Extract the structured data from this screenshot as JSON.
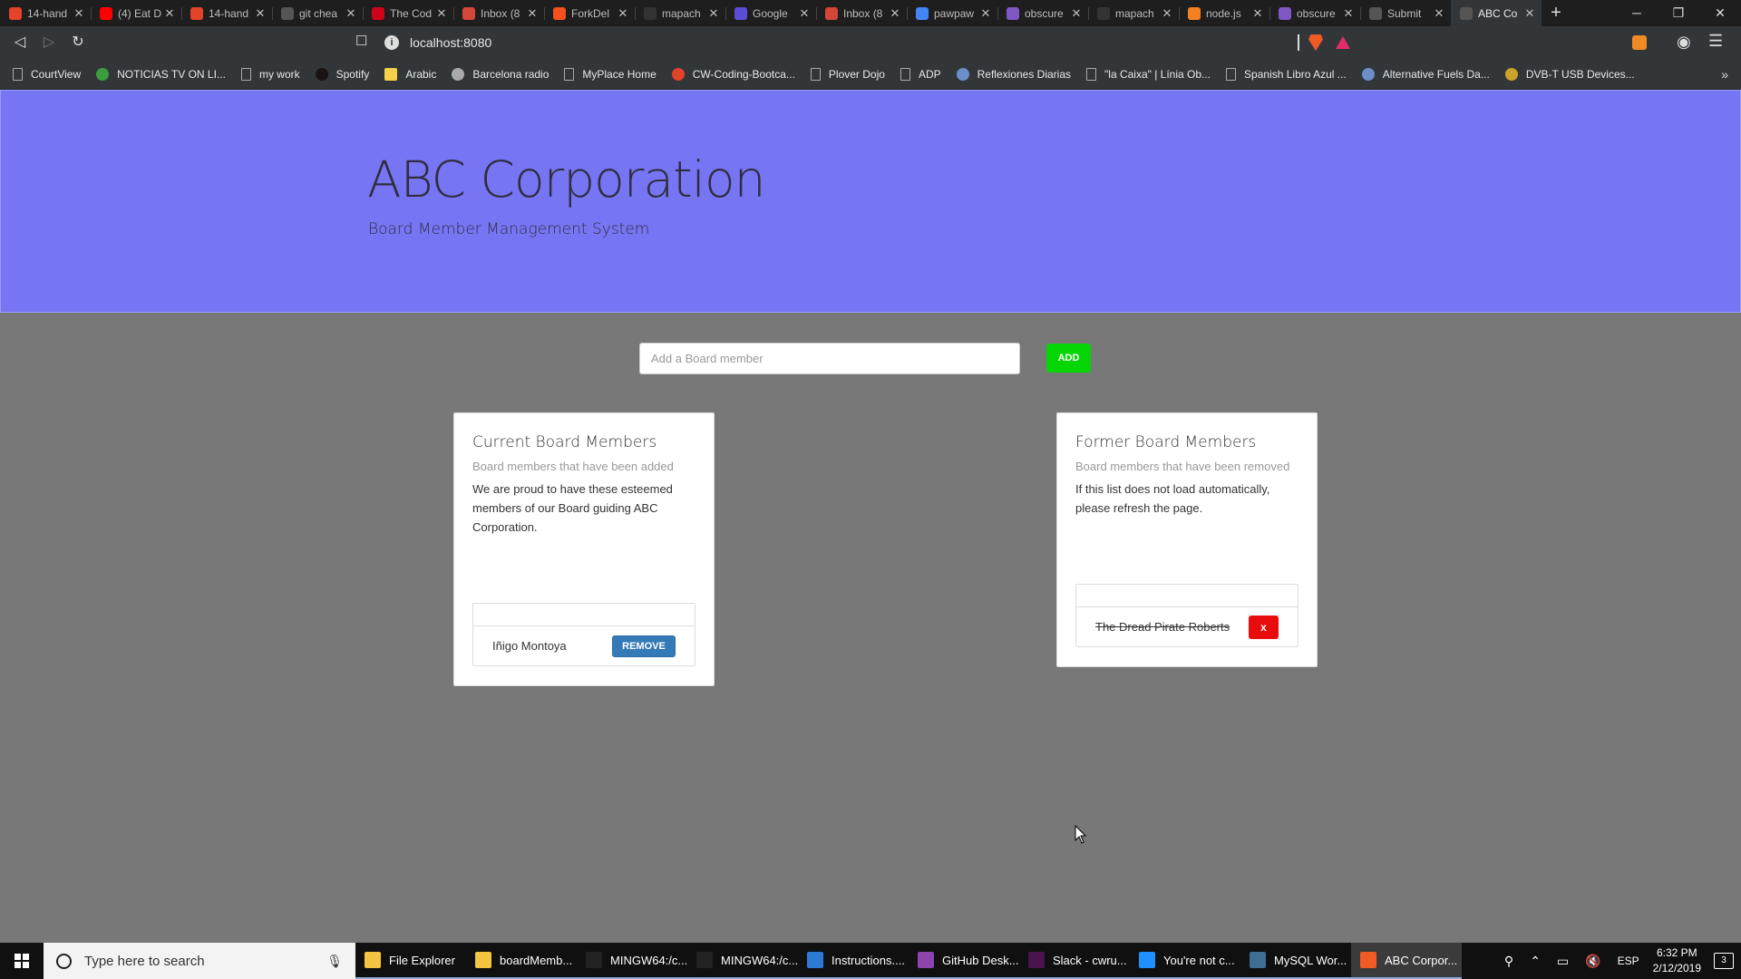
{
  "browser": {
    "tabs": [
      {
        "label": "14-hand",
        "color": "#e24329"
      },
      {
        "label": "(4) Eat D",
        "color": "#ff0000"
      },
      {
        "label": "14-hand",
        "color": "#e24329"
      },
      {
        "label": "git chea",
        "color": "#555555"
      },
      {
        "label": "The Cod",
        "color": "#d0021b"
      },
      {
        "label": "Inbox (8",
        "color": "#d44638"
      },
      {
        "label": "ForkDel",
        "color": "#f4511e"
      },
      {
        "label": "mapach",
        "color": "#333333"
      },
      {
        "label": "Google",
        "color": "#5b4dd6"
      },
      {
        "label": "Inbox (8",
        "color": "#d44638"
      },
      {
        "label": "pawpaw",
        "color": "#4285f4"
      },
      {
        "label": "obscure",
        "color": "#7e57c2"
      },
      {
        "label": "mapach",
        "color": "#333333"
      },
      {
        "label": "node.js",
        "color": "#f48024"
      },
      {
        "label": "obscure",
        "color": "#7e57c2"
      },
      {
        "label": "Submit",
        "color": "#555555"
      },
      {
        "label": "ABC Co",
        "color": "#555555",
        "active": true
      }
    ],
    "close_glyph": "✕",
    "new_tab": "+",
    "window_controls": {
      "minimize": "─",
      "restore": "❐",
      "close": "✕"
    },
    "url": "localhost:8080",
    "bookmarks": [
      {
        "label": "CourtView",
        "icon": "doc"
      },
      {
        "label": "NOTICIAS TV ON LI...",
        "icon": "round",
        "color": "#3c9d3c"
      },
      {
        "label": "my work",
        "icon": "doc"
      },
      {
        "label": "Spotify",
        "icon": "round",
        "color": "#191414"
      },
      {
        "label": "Arabic",
        "icon": "folder"
      },
      {
        "label": "Barcelona radio",
        "icon": "round",
        "color": "#aaaaaa"
      },
      {
        "label": "MyPlace Home",
        "icon": "doc"
      },
      {
        "label": "CW-Coding-Bootca...",
        "icon": "round",
        "color": "#e24329"
      },
      {
        "label": "Plover Dojo",
        "icon": "doc"
      },
      {
        "label": "ADP",
        "icon": "doc"
      },
      {
        "label": "Reflexiones Diarias",
        "icon": "round",
        "color": "#6d8fc9"
      },
      {
        "label": "\"la Caixa\" | Línia Ob...",
        "icon": "doc"
      },
      {
        "label": "Spanish Libro Azul ...",
        "icon": "doc"
      },
      {
        "label": "Alternative Fuels Da...",
        "icon": "round",
        "color": "#6d8fc9"
      },
      {
        "label": "DVB-T USB Devices...",
        "icon": "round",
        "color": "#c9a227"
      }
    ],
    "bookmarks_overflow": "»"
  },
  "app": {
    "title": "ABC Corporation",
    "subtitle": "Board Member Management System",
    "add_placeholder": "Add a Board member",
    "add_label": "ADD",
    "current": {
      "title": "Current Board Members",
      "subtitle": "Board members that have been added",
      "text": "We are proud to have these esteemed members of our Board guiding ABC Corporation.",
      "members": [
        {
          "name": "Iñigo Montoya",
          "action": "REMOVE"
        }
      ]
    },
    "former": {
      "title": "Former Board Members",
      "subtitle": "Board members that have been removed",
      "text": "If this list does not load automatically, please refresh the page.",
      "members": [
        {
          "name": "The Dread Pirate Roberts",
          "action": "x"
        }
      ]
    },
    "colors": {
      "jumbotron": "#7775f3",
      "add_button": "#06d606",
      "remove_button": "#337ab7",
      "x_button": "#e80c0c"
    }
  },
  "taskbar": {
    "search_placeholder": "Type here to search",
    "tasks": [
      {
        "label": "File Explorer",
        "color": "#f5c542"
      },
      {
        "label": "boardMemb...",
        "color": "#f5c542"
      },
      {
        "label": "MINGW64:/c...",
        "color": "#222222"
      },
      {
        "label": "MINGW64:/c...",
        "color": "#222222"
      },
      {
        "label": "Instructions....",
        "color": "#2b7bd6"
      },
      {
        "label": "GitHub Desk...",
        "color": "#8e44ad"
      },
      {
        "label": "Slack - cwru...",
        "color": "#4a154b"
      },
      {
        "label": "You're not c...",
        "color": "#1e90ff"
      },
      {
        "label": "MySQL Wor...",
        "color": "#3e6e93"
      },
      {
        "label": "ABC Corpor...",
        "color": "#f05a24",
        "active": true
      }
    ],
    "language": "ESP",
    "time": "6:32 PM",
    "date": "2/12/2019",
    "notification_count": "3"
  }
}
